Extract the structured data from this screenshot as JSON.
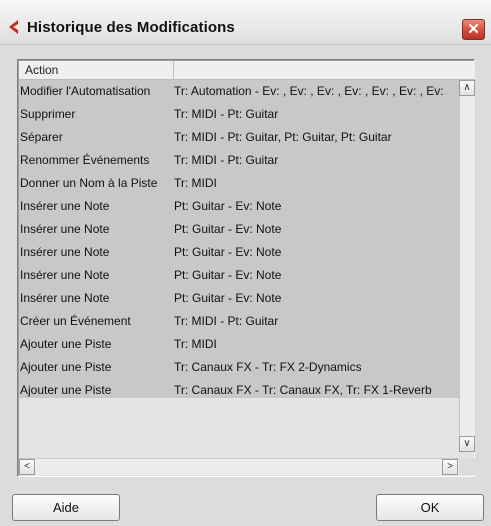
{
  "window": {
    "title": "Historique des Modifications",
    "close_glyph": "✕"
  },
  "list": {
    "columns": [
      "Action",
      ""
    ],
    "rows": [
      {
        "action": "Modifier l'Automatisation",
        "detail": "Tr: Automation - Ev: , Ev: , Ev: , Ev: , Ev: , Ev: , Ev:"
      },
      {
        "action": "Supprimer",
        "detail": "Tr: MIDI - Pt: Guitar"
      },
      {
        "action": "Séparer",
        "detail": "Tr: MIDI - Pt: Guitar, Pt: Guitar, Pt: Guitar"
      },
      {
        "action": "Renommer Événements",
        "detail": "Tr: MIDI - Pt: Guitar"
      },
      {
        "action": "Donner un Nom à la Piste",
        "detail": "Tr: MIDI"
      },
      {
        "action": "Insérer une Note",
        "detail": "Pt: Guitar - Ev: Note"
      },
      {
        "action": "Insérer une Note",
        "detail": "Pt: Guitar - Ev: Note"
      },
      {
        "action": "Insérer une Note",
        "detail": "Pt: Guitar - Ev: Note"
      },
      {
        "action": "Insérer une Note",
        "detail": "Pt: Guitar - Ev: Note"
      },
      {
        "action": "Insérer une Note",
        "detail": "Pt: Guitar - Ev: Note"
      },
      {
        "action": "Créer un Événement",
        "detail": "Tr: MIDI - Pt: Guitar"
      },
      {
        "action": "Ajouter une Piste",
        "detail": "Tr: MIDI"
      },
      {
        "action": "Ajouter une Piste",
        "detail": "Tr: Canaux FX - Tr: FX 2-Dynamics"
      },
      {
        "action": "Ajouter une Piste",
        "detail": "Tr: Canaux FX - Tr: Canaux FX, Tr: FX 1-Reverb"
      }
    ],
    "scroll_up": "∧",
    "scroll_down": "∨",
    "scroll_left": "<",
    "scroll_right": ">"
  },
  "buttons": {
    "help_label": "Aide",
    "ok_label": "OK"
  },
  "colors": {
    "close_button": "#d44e3c",
    "title_icon": "#c8281e",
    "row_background": "#c8c8c8"
  }
}
